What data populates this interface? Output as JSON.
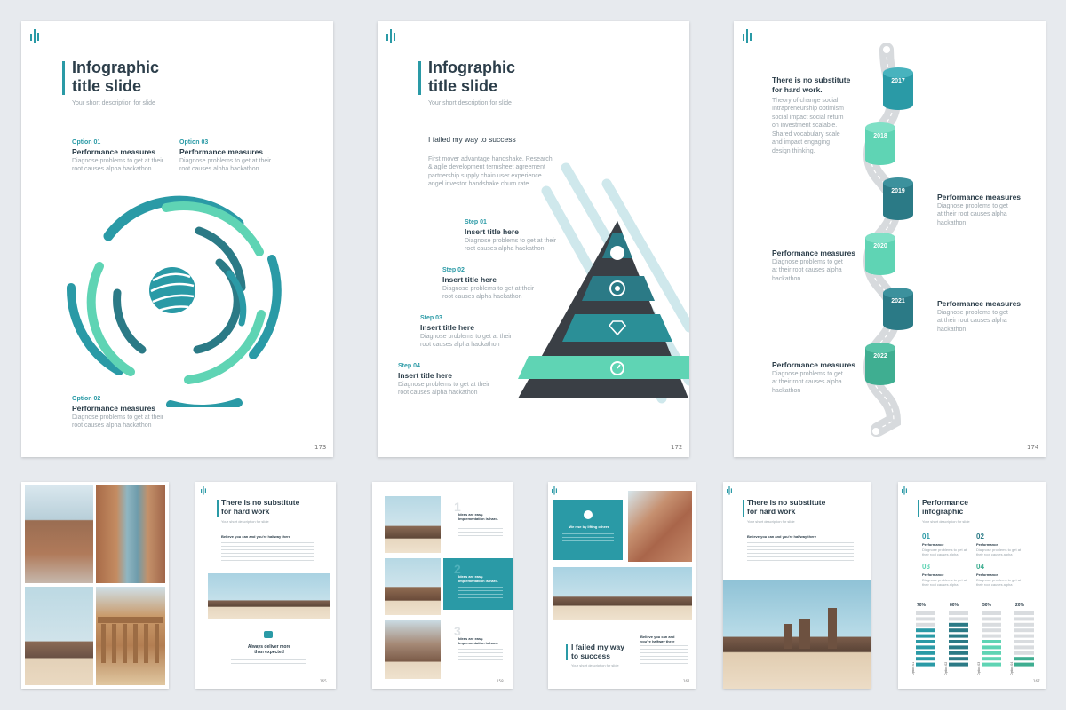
{
  "slide173": {
    "title_line1": "Infographic",
    "title_line2": "title slide",
    "description": "Your short description for slide",
    "options": [
      {
        "label": "Option 01",
        "heading": "Performance measures",
        "text1": "Diagnose problems to get at their",
        "text2": "root causes alpha hackathon"
      },
      {
        "label": "Option 03",
        "heading": "Performance measures",
        "text1": "Diagnose problems to get at their",
        "text2": "root causes alpha hackathon"
      },
      {
        "label": "Option 02",
        "heading": "Performance measures",
        "text1": "Diagnose problems to get at their",
        "text2": "root causes alpha hackathon"
      }
    ],
    "page_number": "173"
  },
  "slide172": {
    "title_line1": "Infographic",
    "title_line2": "title slide",
    "description": "Your short description for slide",
    "intro_heading": "I failed my way to success",
    "intro_lines": [
      "First mover advantage handshake. Research",
      "& agile development termsheet agreement",
      "partnership supply chain user experience",
      "angel investor handshake churn rate."
    ],
    "steps": [
      {
        "label": "Step 01",
        "heading": "Insert title here",
        "text1": "Diagnose problems to get at their",
        "text2": "root causes alpha hackathon"
      },
      {
        "label": "Step 02",
        "heading": "Insert title here",
        "text1": "Diagnose problems to get at their",
        "text2": "root causes alpha hackathon"
      },
      {
        "label": "Step 03",
        "heading": "Insert title here",
        "text1": "Diagnose problems to get at their",
        "text2": "root causes alpha hackathon"
      },
      {
        "label": "Step 04",
        "heading": "Insert title here",
        "text1": "Diagnose problems to get at their",
        "text2": "root causes alpha hackathon"
      }
    ],
    "page_number": "172"
  },
  "slide174": {
    "heading_line1": "There is no substitute",
    "heading_line2": "for hard work.",
    "body_lines": [
      "Theory of change social",
      "Intrapreneurship optimism",
      "social impact social return",
      "on investment scalable.",
      "Shared vocabulary scale",
      "and impact engaging",
      "design thinking."
    ],
    "years": [
      "2017",
      "2018",
      "2019",
      "2020",
      "2021",
      "2022"
    ],
    "blocks": [
      {
        "heading": "Performance measures",
        "text1": "Diagnose problems to get",
        "text2": "at their root causes alpha",
        "text3": "hackathon"
      },
      {
        "heading": "Performance measures",
        "text1": "Diagnose problems to get",
        "text2": "at their root causes alpha",
        "text3": "hackathon"
      },
      {
        "heading": "Performance measures",
        "text1": "Diagnose problems to get",
        "text2": "at their root causes alpha",
        "text3": "hackathon"
      },
      {
        "heading": "Performance measures",
        "text1": "Diagnose problems to get",
        "text2": "at their root causes alpha",
        "text3": "hackathon"
      }
    ],
    "page_number": "174"
  },
  "thumb2": {
    "title_line1": "There is no substitute",
    "title_line2": "for hard work",
    "desc": "Your short description for slide",
    "lead": "Believe you can and you're halfway there",
    "caption_line1": "Always deliver more",
    "caption_line2": "than expected",
    "page_number": "165"
  },
  "thumb3": {
    "nums": [
      "1",
      "2",
      "3"
    ],
    "headings": [
      "Ideas are easy.",
      "Ideas are easy.",
      "Ideas are easy."
    ],
    "subheadings": [
      "Implementation is hard.",
      "Implementation is hard.",
      "Implementation is hard."
    ],
    "page_number": "158"
  },
  "thumb4": {
    "box_heading": "We rise by lifting others",
    "title_line1": "I failed my way",
    "title_line2": "to success",
    "desc": "Your short description for slide",
    "side_line1": "Believe you can and",
    "side_line2": "you're halfway there",
    "page_number": "161"
  },
  "thumb5": {
    "title_line1": "There is no substitute",
    "title_line2": "for hard work",
    "desc": "Your short description for slide",
    "lead": "Believe you can and you're halfway there"
  },
  "thumb6": {
    "title_line1": "Performance",
    "title_line2": "infographic",
    "desc": "Your short description for slide",
    "items": [
      {
        "num": "01",
        "heading": "Performance",
        "text": "Diagnose problems to get at their root causes alpha"
      },
      {
        "num": "02",
        "heading": "Performance",
        "text": "Diagnose problems to get at their root causes alpha"
      },
      {
        "num": "03",
        "heading": "Performance",
        "text": "Diagnose problems to get at their root causes alpha"
      },
      {
        "num": "04",
        "heading": "Performance",
        "text": "Diagnose problems to get at their root causes alpha"
      }
    ],
    "bars": [
      {
        "pct": "70%",
        "value": 70,
        "label": "Option 01",
        "color": "#2a9aa6"
      },
      {
        "pct": "80%",
        "value": 80,
        "label": "Option 02",
        "color": "#2b7a86"
      },
      {
        "pct": "50%",
        "value": 50,
        "label": "Option 03",
        "color": "#5fd4b4"
      },
      {
        "pct": "20%",
        "value": 20,
        "label": "Option 04",
        "color": "#3fae91"
      }
    ],
    "page_number": "167"
  },
  "colors": {
    "teal": "#2a9aa6",
    "dark_teal": "#2b7a86",
    "mint": "#5fd4b4",
    "charcoal": "#3a3f45"
  }
}
